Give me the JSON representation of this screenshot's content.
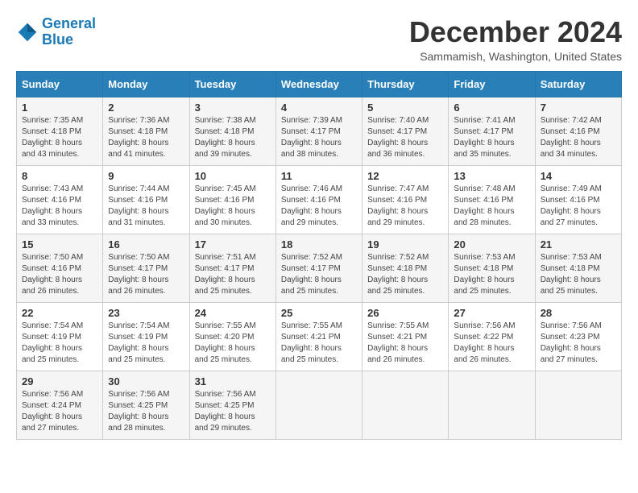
{
  "logo": {
    "line1": "General",
    "line2": "Blue"
  },
  "title": "December 2024",
  "subtitle": "Sammamish, Washington, United States",
  "weekdays": [
    "Sunday",
    "Monday",
    "Tuesday",
    "Wednesday",
    "Thursday",
    "Friday",
    "Saturday"
  ],
  "weeks": [
    [
      {
        "day": "1",
        "info": "Sunrise: 7:35 AM\nSunset: 4:18 PM\nDaylight: 8 hours\nand 43 minutes."
      },
      {
        "day": "2",
        "info": "Sunrise: 7:36 AM\nSunset: 4:18 PM\nDaylight: 8 hours\nand 41 minutes."
      },
      {
        "day": "3",
        "info": "Sunrise: 7:38 AM\nSunset: 4:18 PM\nDaylight: 8 hours\nand 39 minutes."
      },
      {
        "day": "4",
        "info": "Sunrise: 7:39 AM\nSunset: 4:17 PM\nDaylight: 8 hours\nand 38 minutes."
      },
      {
        "day": "5",
        "info": "Sunrise: 7:40 AM\nSunset: 4:17 PM\nDaylight: 8 hours\nand 36 minutes."
      },
      {
        "day": "6",
        "info": "Sunrise: 7:41 AM\nSunset: 4:17 PM\nDaylight: 8 hours\nand 35 minutes."
      },
      {
        "day": "7",
        "info": "Sunrise: 7:42 AM\nSunset: 4:16 PM\nDaylight: 8 hours\nand 34 minutes."
      }
    ],
    [
      {
        "day": "8",
        "info": "Sunrise: 7:43 AM\nSunset: 4:16 PM\nDaylight: 8 hours\nand 33 minutes."
      },
      {
        "day": "9",
        "info": "Sunrise: 7:44 AM\nSunset: 4:16 PM\nDaylight: 8 hours\nand 31 minutes."
      },
      {
        "day": "10",
        "info": "Sunrise: 7:45 AM\nSunset: 4:16 PM\nDaylight: 8 hours\nand 30 minutes."
      },
      {
        "day": "11",
        "info": "Sunrise: 7:46 AM\nSunset: 4:16 PM\nDaylight: 8 hours\nand 29 minutes."
      },
      {
        "day": "12",
        "info": "Sunrise: 7:47 AM\nSunset: 4:16 PM\nDaylight: 8 hours\nand 29 minutes."
      },
      {
        "day": "13",
        "info": "Sunrise: 7:48 AM\nSunset: 4:16 PM\nDaylight: 8 hours\nand 28 minutes."
      },
      {
        "day": "14",
        "info": "Sunrise: 7:49 AM\nSunset: 4:16 PM\nDaylight: 8 hours\nand 27 minutes."
      }
    ],
    [
      {
        "day": "15",
        "info": "Sunrise: 7:50 AM\nSunset: 4:16 PM\nDaylight: 8 hours\nand 26 minutes."
      },
      {
        "day": "16",
        "info": "Sunrise: 7:50 AM\nSunset: 4:17 PM\nDaylight: 8 hours\nand 26 minutes."
      },
      {
        "day": "17",
        "info": "Sunrise: 7:51 AM\nSunset: 4:17 PM\nDaylight: 8 hours\nand 25 minutes."
      },
      {
        "day": "18",
        "info": "Sunrise: 7:52 AM\nSunset: 4:17 PM\nDaylight: 8 hours\nand 25 minutes."
      },
      {
        "day": "19",
        "info": "Sunrise: 7:52 AM\nSunset: 4:18 PM\nDaylight: 8 hours\nand 25 minutes."
      },
      {
        "day": "20",
        "info": "Sunrise: 7:53 AM\nSunset: 4:18 PM\nDaylight: 8 hours\nand 25 minutes."
      },
      {
        "day": "21",
        "info": "Sunrise: 7:53 AM\nSunset: 4:18 PM\nDaylight: 8 hours\nand 25 minutes."
      }
    ],
    [
      {
        "day": "22",
        "info": "Sunrise: 7:54 AM\nSunset: 4:19 PM\nDaylight: 8 hours\nand 25 minutes."
      },
      {
        "day": "23",
        "info": "Sunrise: 7:54 AM\nSunset: 4:19 PM\nDaylight: 8 hours\nand 25 minutes."
      },
      {
        "day": "24",
        "info": "Sunrise: 7:55 AM\nSunset: 4:20 PM\nDaylight: 8 hours\nand 25 minutes."
      },
      {
        "day": "25",
        "info": "Sunrise: 7:55 AM\nSunset: 4:21 PM\nDaylight: 8 hours\nand 25 minutes."
      },
      {
        "day": "26",
        "info": "Sunrise: 7:55 AM\nSunset: 4:21 PM\nDaylight: 8 hours\nand 26 minutes."
      },
      {
        "day": "27",
        "info": "Sunrise: 7:56 AM\nSunset: 4:22 PM\nDaylight: 8 hours\nand 26 minutes."
      },
      {
        "day": "28",
        "info": "Sunrise: 7:56 AM\nSunset: 4:23 PM\nDaylight: 8 hours\nand 27 minutes."
      }
    ],
    [
      {
        "day": "29",
        "info": "Sunrise: 7:56 AM\nSunset: 4:24 PM\nDaylight: 8 hours\nand 27 minutes."
      },
      {
        "day": "30",
        "info": "Sunrise: 7:56 AM\nSunset: 4:25 PM\nDaylight: 8 hours\nand 28 minutes."
      },
      {
        "day": "31",
        "info": "Sunrise: 7:56 AM\nSunset: 4:25 PM\nDaylight: 8 hours\nand 29 minutes."
      },
      {
        "day": "",
        "info": ""
      },
      {
        "day": "",
        "info": ""
      },
      {
        "day": "",
        "info": ""
      },
      {
        "day": "",
        "info": ""
      }
    ]
  ]
}
